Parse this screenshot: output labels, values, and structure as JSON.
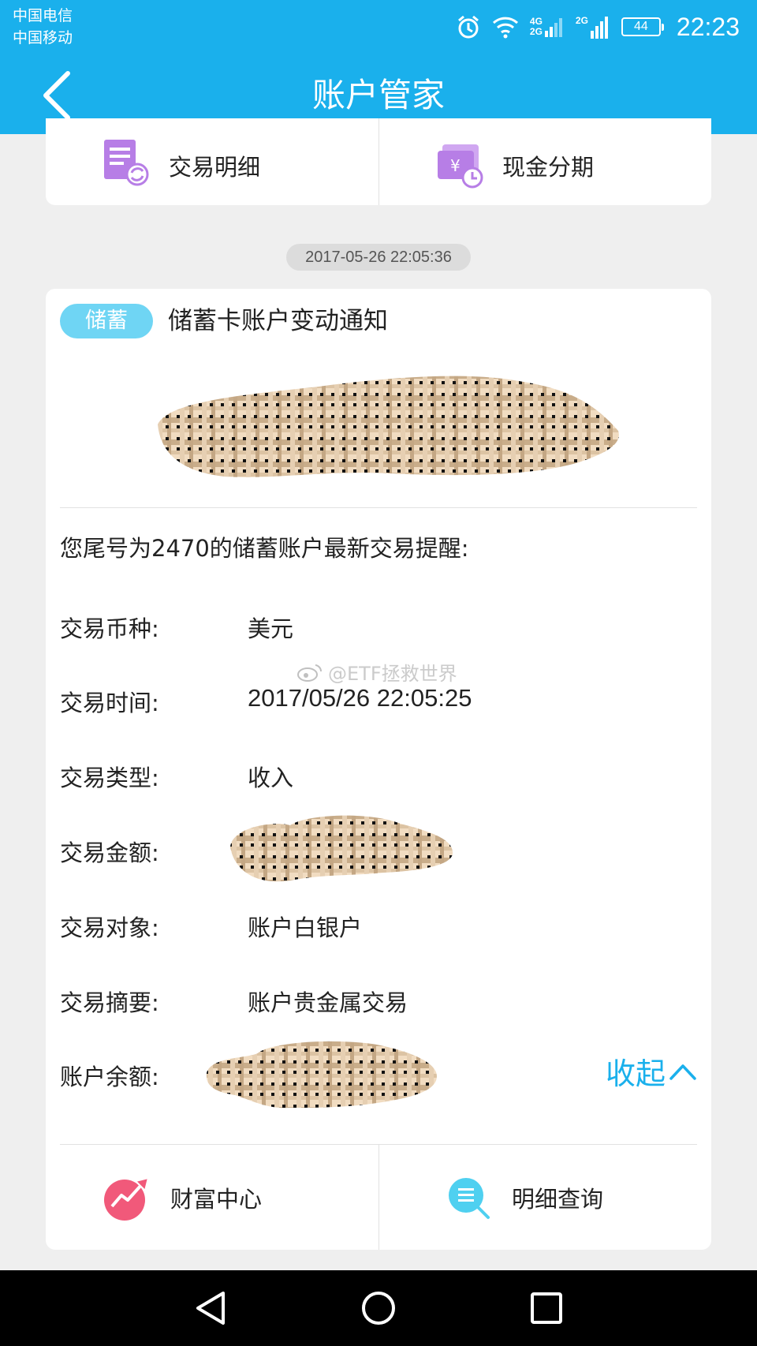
{
  "status_bar": {
    "carrier_1": "中国电信",
    "carrier_2": "中国移动",
    "network_1": "4G",
    "network_1b": "2G",
    "network_2": "2G",
    "battery": "44",
    "time": "22:23"
  },
  "app_bar": {
    "title": "账户管家",
    "back_icon": "back-arrow-icon"
  },
  "top_card": {
    "items": [
      {
        "label": "交易明细",
        "icon": "transaction-detail-icon"
      },
      {
        "label": "现金分期",
        "icon": "cash-installment-icon"
      }
    ]
  },
  "message": {
    "timestamp": "2017-05-26 22:05:36",
    "tag": "储蓄",
    "title": "储蓄卡账户变动通知",
    "intro": "您尾号为2470的储蓄账户最新交易提醒:",
    "rows": [
      {
        "label": "交易币种:",
        "value": "美元"
      },
      {
        "label": "交易时间:",
        "value": "2017/05/26 22:05:25"
      },
      {
        "label": "交易类型:",
        "value": "收入"
      },
      {
        "label": "交易金额:",
        "value": ""
      },
      {
        "label": "交易对象:",
        "value": "账户白银户"
      },
      {
        "label": "交易摘要:",
        "value": "账户贵金属交易"
      },
      {
        "label": "账户余额:",
        "value": ""
      }
    ],
    "collapse_label": "收起",
    "watermark": "@ETF拯救世界",
    "bottom_actions": [
      {
        "label": "财富中心",
        "icon": "wealth-center-icon"
      },
      {
        "label": "明细查询",
        "icon": "detail-query-icon"
      }
    ]
  },
  "colors": {
    "primary": "#1ab0ec",
    "tag": "#6fd5f4",
    "background": "#efefef",
    "purple_icon": "#b77ee6",
    "pink_icon": "#f1597a",
    "cyan_icon": "#4fd0f0"
  }
}
